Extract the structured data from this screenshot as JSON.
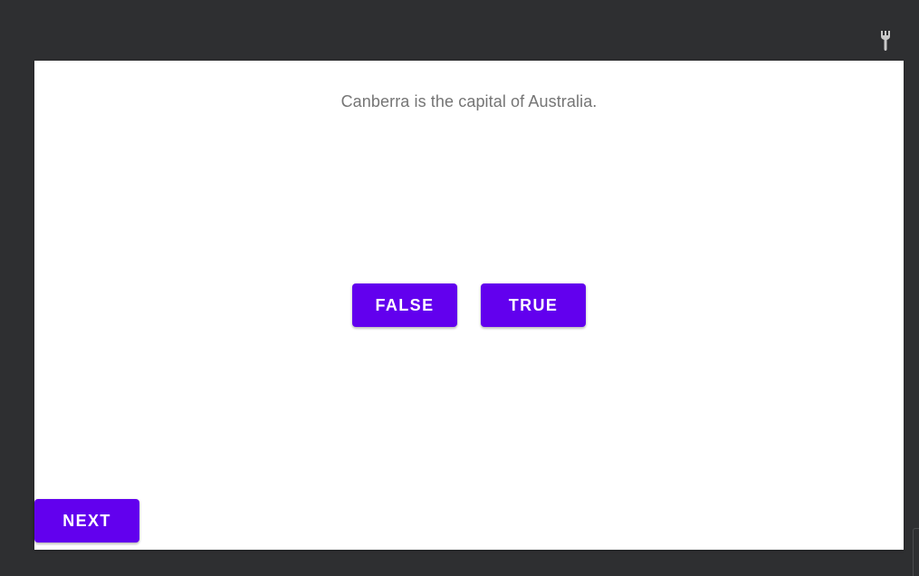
{
  "toolbar": {
    "tool_icon": "wrench-icon"
  },
  "quiz": {
    "question": "Canberra is the capital of Australia.",
    "false_label": "FALSE",
    "true_label": "TRUE",
    "next_label": "NEXT"
  },
  "colors": {
    "background": "#2e2f31",
    "surface": "#ffffff",
    "primary": "#6200ee",
    "question_text": "#757575"
  }
}
